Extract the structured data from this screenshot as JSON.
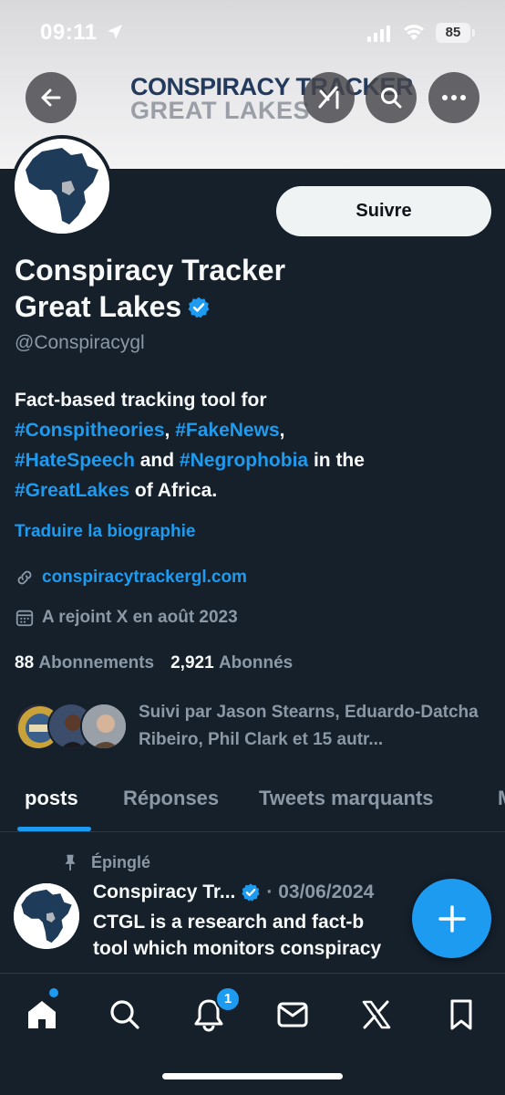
{
  "status_bar": {
    "time": "09:11",
    "battery": "85"
  },
  "banner": {
    "logo_line1": "CONSPIRACY TRACKER",
    "logo_line2": "GREAT LAKES"
  },
  "header_buttons": [
    "back-icon",
    "grok-icon",
    "search-icon",
    "more-icon"
  ],
  "profile": {
    "name_line1": "Conspiracy Tracker",
    "name_line2": "Great Lakes",
    "handle": "@Conspiracygl",
    "follow_label": "Suivre",
    "bio": {
      "t1": "Fact-based tracking tool for",
      "h1": "#Conspitheories",
      "t2": ", ",
      "h2": "#FakeNews",
      "t3": ",",
      "h3": "#HateSpeech",
      "t4": " and ",
      "h4": "#Negrophobia",
      "t5": " in the",
      "h5": "#GreatLakes",
      "t6": " of Africa."
    },
    "translate_label": "Traduire la biographie",
    "website": "conspiracytrackergl.com",
    "joined": "A rejoint X en août 2023",
    "following_count": "88",
    "following_label": "Abonnements",
    "followers_count": "2,921",
    "followers_label": "Abonnés",
    "followed_by": "Suivi par Jason Stearns, Eduardo-Datcha Ribeiro, Phil Clark et 15 autr..."
  },
  "tabs": [
    {
      "label": "posts"
    },
    {
      "label": "Réponses"
    },
    {
      "label": "Tweets marquants"
    },
    {
      "label": "M"
    }
  ],
  "pinned_post": {
    "pinned_label": "Épinglé",
    "author": "Conspiracy Tr...",
    "date": "· 03/06/2024",
    "text_line1": "CTGL is a research and fact-b",
    "text_line2": "tool which monitors conspiracy"
  },
  "bottom_nav": {
    "notification_count": "1"
  },
  "colors": {
    "background": "#15202b",
    "accent": "#1d9bf0",
    "muted": "#8b98a5"
  }
}
